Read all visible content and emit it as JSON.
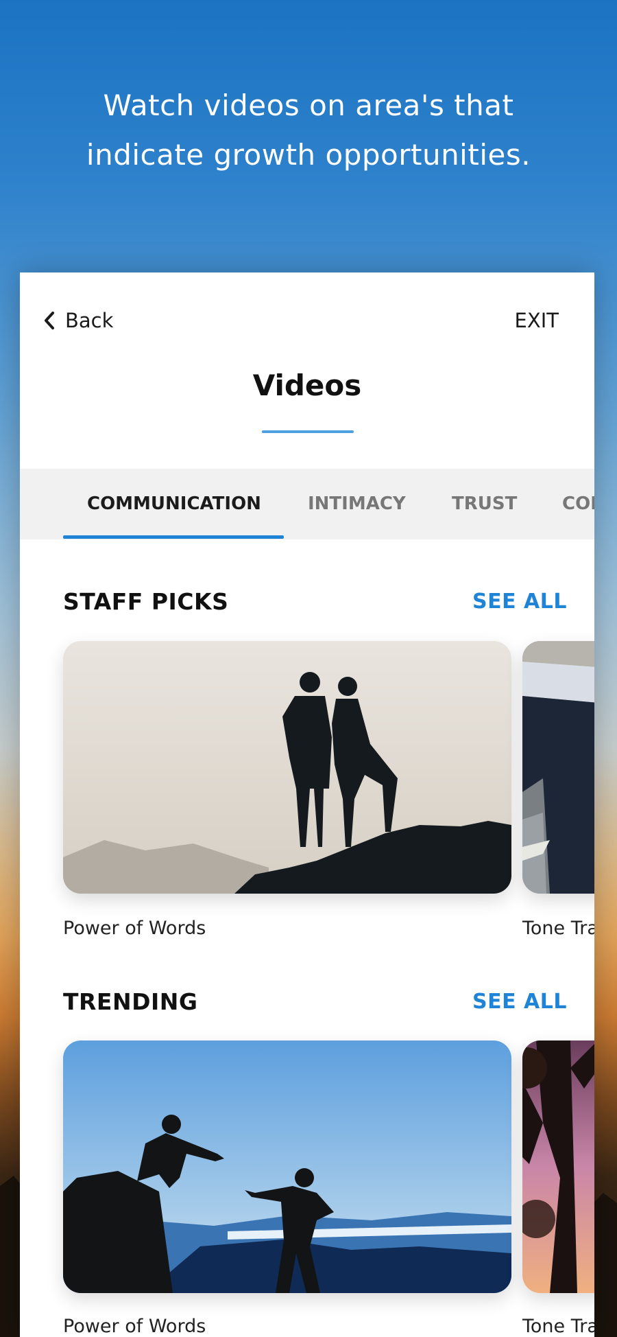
{
  "headline": {
    "line1": "Watch videos on area's that",
    "line2": "indicate growth opportunities."
  },
  "nav": {
    "back_label": "Back",
    "exit_label": "EXIT"
  },
  "page_title": "Videos",
  "tabs": [
    {
      "label": "COMMUNICATION",
      "active": true
    },
    {
      "label": "INTIMACY",
      "active": false
    },
    {
      "label": "TRUST",
      "active": false
    },
    {
      "label": "COI",
      "active": false
    }
  ],
  "sections": [
    {
      "title": "STAFF PICKS",
      "see_all": "SEE ALL",
      "videos": [
        {
          "caption": "Power of Words"
        },
        {
          "caption": "Tone Tra"
        }
      ]
    },
    {
      "title": "TRENDING",
      "see_all": "SEE ALL",
      "videos": [
        {
          "caption": "Power of Words"
        },
        {
          "caption": "Tone Tra"
        }
      ]
    }
  ],
  "colors": {
    "accent": "#1f84d6",
    "title_underline": "#4fa0e0",
    "tab_bar_bg": "#f1f1f1"
  }
}
